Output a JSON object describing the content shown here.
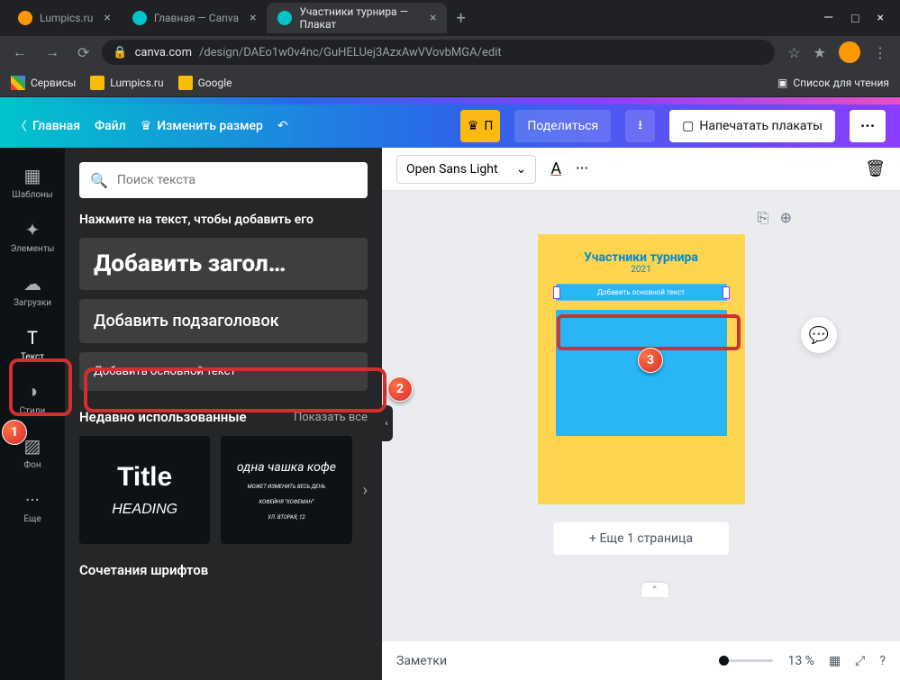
{
  "browser": {
    "tabs": [
      {
        "label": "Lumpics.ru"
      },
      {
        "label": "Главная — Canva"
      },
      {
        "label": "Участники турнира — Плакат"
      }
    ],
    "url_domain": "canva.com",
    "url_path": "/design/DAEo1w0v4nc/GuHELUej3AzxAwVVovbMGA/edit",
    "bookmarks": {
      "apps": "Сервисы",
      "b1": "Lumpics.ru",
      "b2": "Google",
      "reading": "Список для чтения"
    }
  },
  "header": {
    "home": "Главная",
    "file": "Файл",
    "resize": "Изменить размер",
    "pro_badge": "П",
    "share": "Поделиться",
    "print": "Напечатать плакаты"
  },
  "toolrail": [
    {
      "label": "Шаблоны"
    },
    {
      "label": "Элементы"
    },
    {
      "label": "Загрузки"
    },
    {
      "label": "Текст"
    },
    {
      "label": "Стили"
    },
    {
      "label": "Фон"
    },
    {
      "label": "Еще"
    }
  ],
  "panel": {
    "search_placeholder": "Поиск текста",
    "hint": "Нажмите на текст, чтобы добавить его",
    "add_heading": "Добавить загол…",
    "add_subheading": "Добавить подзаголовок",
    "add_body": "Добавить основной текст",
    "recent_title": "Недавно использованные",
    "show_all": "Показать все",
    "recent1_a": "Title",
    "recent1_b": "HEADING",
    "recent2": "одна чашка кофе",
    "recent2_sub1": "МОЖЕТ ИЗМЕНИТЬ ВЕСЬ ДЕНЬ",
    "recent2_sub2": "КОФЕЙНЯ \"КОФЕМАН\"",
    "recent2_sub3": "УЛ. ВТОРАЯ, 12",
    "combos_title": "Сочетания шрифтов"
  },
  "canvas": {
    "font": "Open Sans Light",
    "poster_title": "Участники турнира",
    "poster_year": "2021",
    "poster_textbox": "Добавить основной текст",
    "add_page": "+ Еще 1 страница"
  },
  "footer": {
    "notes": "Заметки",
    "zoom": "13 %"
  },
  "callouts": {
    "c1": "1",
    "c2": "2",
    "c3": "3"
  }
}
